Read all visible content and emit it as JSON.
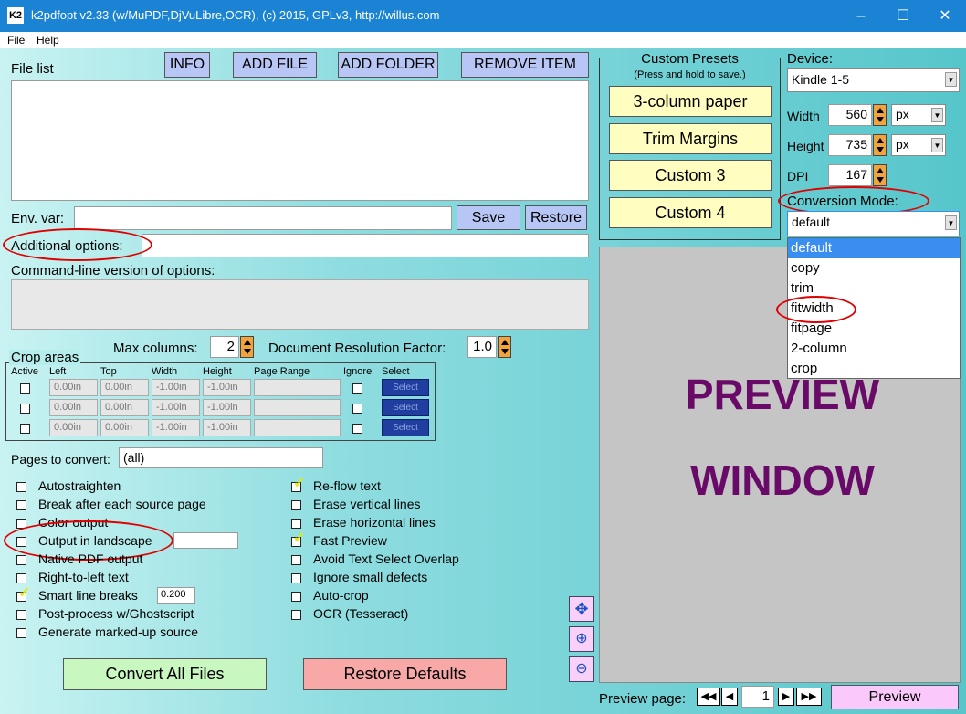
{
  "window": {
    "title": "k2pdfopt v2.33 (w/MuPDF,DjVuLibre,OCR), (c) 2015, GPLv3, http://willus.com",
    "icon": "K2",
    "controls": [
      "–",
      "☐",
      "✕"
    ]
  },
  "menu": [
    "File",
    "Help"
  ],
  "file_list": {
    "label": "File list",
    "buttons": [
      "INFO",
      "ADD FILE",
      "ADD FOLDER",
      "REMOVE ITEM"
    ]
  },
  "env_var": {
    "label": "Env. var:",
    "save": "Save",
    "restore": "Restore",
    "value": ""
  },
  "additional_options": {
    "label": "Additional options:",
    "value": ""
  },
  "cmdline": {
    "label": "Command-line version of options:",
    "value": ""
  },
  "max_columns": {
    "label": "Max columns:",
    "value": "2"
  },
  "doc_res": {
    "label": "Document Resolution Factor:",
    "value": "1.0"
  },
  "crop": {
    "title": "Crop areas",
    "headers": [
      "Active",
      "Left",
      "Top",
      "Width",
      "Height",
      "Page Range",
      "Ignore",
      "Select"
    ],
    "rows": [
      {
        "left": "0.00in",
        "top": "0.00in",
        "width": "-1.00in",
        "height": "-1.00in",
        "range": "",
        "select": "Select"
      },
      {
        "left": "0.00in",
        "top": "0.00in",
        "width": "-1.00in",
        "height": "-1.00in",
        "range": "",
        "select": "Select"
      },
      {
        "left": "0.00in",
        "top": "0.00in",
        "width": "-1.00in",
        "height": "-1.00in",
        "range": "",
        "select": "Select"
      }
    ]
  },
  "pages": {
    "label": "Pages to convert:",
    "value": "(all)"
  },
  "options_left": [
    {
      "label": "Autostraighten",
      "checked": false
    },
    {
      "label": "Break after each source page",
      "checked": false
    },
    {
      "label": "Color output",
      "checked": false
    },
    {
      "label": "Output in landscape",
      "checked": false
    },
    {
      "label": "Native PDF output",
      "checked": false
    },
    {
      "label": "Right-to-left text",
      "checked": false
    },
    {
      "label": "Smart line breaks",
      "checked": true,
      "extra": "0.200"
    },
    {
      "label": "Post-process w/Ghostscript",
      "checked": false
    },
    {
      "label": "Generate marked-up source",
      "checked": false
    }
  ],
  "options_right": [
    {
      "label": "Re-flow text",
      "checked": true
    },
    {
      "label": "Erase vertical lines",
      "checked": false
    },
    {
      "label": "Erase horizontal lines",
      "checked": false
    },
    {
      "label": "Fast Preview",
      "checked": true
    },
    {
      "label": "Avoid Text Select Overlap",
      "checked": false
    },
    {
      "label": "Ignore small defects",
      "checked": false
    },
    {
      "label": "Auto-crop",
      "checked": false
    },
    {
      "label": "OCR (Tesseract)",
      "checked": false
    }
  ],
  "bottom": {
    "convert": "Convert All Files",
    "restore": "Restore Defaults"
  },
  "presets": {
    "title": "Custom Presets",
    "subtitle": "(Press and hold to save.)",
    "buttons": [
      "3-column paper",
      "Trim Margins",
      "Custom 3",
      "Custom 4"
    ]
  },
  "device": {
    "label": "Device:",
    "value": "Kindle 1-5",
    "width_label": "Width",
    "width": "560",
    "width_unit": "px",
    "height_label": "Height",
    "height": "735",
    "height_unit": "px",
    "dpi_label": "DPI",
    "dpi": "167"
  },
  "conversion_mode": {
    "label": "Conversion Mode:",
    "value": "default",
    "options": [
      "default",
      "copy",
      "trim",
      "fitwidth",
      "fitpage",
      "2-column",
      "crop"
    ],
    "highlighted": "default"
  },
  "preview": {
    "line1": "PREVIEW",
    "line2": "WINDOW",
    "page_label": "Preview page:",
    "page": "1",
    "button": "Preview",
    "text_color": "#6a0a68"
  },
  "colors": {
    "titlebar": "#1b83d3",
    "selection": "#3a8ef0",
    "annotation": "#e00000"
  }
}
